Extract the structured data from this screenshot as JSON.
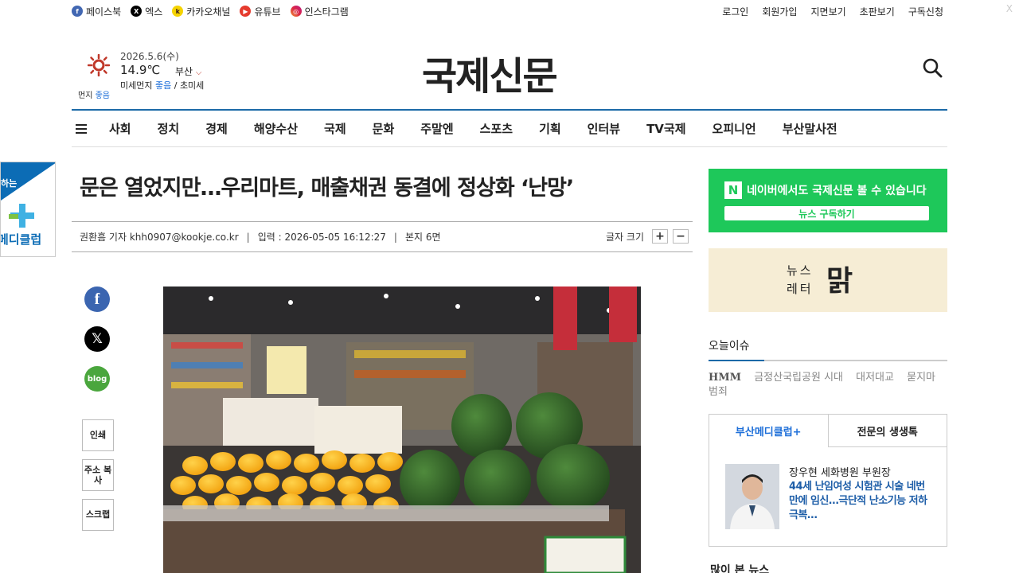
{
  "topbar": {
    "social": [
      {
        "label": "페이스북",
        "icon": "facebook-icon"
      },
      {
        "label": "엑스",
        "icon": "x-icon"
      },
      {
        "label": "카카오채널",
        "icon": "kakao-icon"
      },
      {
        "label": "유튜브",
        "icon": "youtube-icon"
      },
      {
        "label": "인스타그램",
        "icon": "instagram-icon"
      }
    ],
    "links": [
      "로그인",
      "회원가입",
      "지면보기",
      "초판보기",
      "구독신청"
    ],
    "close": "X"
  },
  "weather": {
    "date": "2026.5.6(수)",
    "temp": "14.9℃",
    "city": "부산",
    "dust_label": "미세먼지",
    "dust_value": "좋음",
    "fine_dust_label": "초미세",
    "dust2_label": "먼지",
    "dust2_value": "좋음"
  },
  "site": {
    "logo": "국제신문"
  },
  "nav": [
    "사회",
    "정치",
    "경제",
    "해양수산",
    "국제",
    "문화",
    "주말엔",
    "스포츠",
    "기획",
    "인터뷰",
    "TV국제",
    "오피니언",
    "부산말사전"
  ],
  "left_banner": {
    "line1": "하는",
    "line2": "메디클럽"
  },
  "article": {
    "title": "문은 열었지만…우리마트, 매출채권 동결에 정상화 ‘난망’",
    "reporter": "권환흠 기자 khh0907@kookje.co.kr",
    "input_label": "입력 : 2026-05-05 16:12:27",
    "page": "본지 6면",
    "font_size_label": "글자 크기",
    "font_plus": "+",
    "font_minus": "−"
  },
  "tools": {
    "print": "인쇄",
    "copy": "주소 복사",
    "scrap": "스크랩",
    "blog": "blog"
  },
  "sidebar": {
    "naver_text": "네이버에서도 국제신문 볼 수 있습니다",
    "naver_button": "뉴스 구독하기",
    "newsletter_label": "뉴스 레터",
    "newsletter_logo": "맑",
    "today_title": "오늘이슈",
    "today_keywords": [
      "HMM",
      "금정산국립공원 시대",
      "대저대교",
      "묻지마 범죄"
    ],
    "medi_tab1": "부산메디클럽+",
    "medi_tab2": "전문의 생생톡",
    "medi_name": "장우현 세화병원 부원장",
    "medi_headline": "44세 난임여성 시험관 시술 네번 만에 임신…극단적 난소기능 저하 극복…",
    "popular_title": "많이 본 뉴스"
  },
  "colors": {
    "accent": "#1c6aa8",
    "naver": "#1ec85a",
    "good": "#1e6fd9"
  }
}
